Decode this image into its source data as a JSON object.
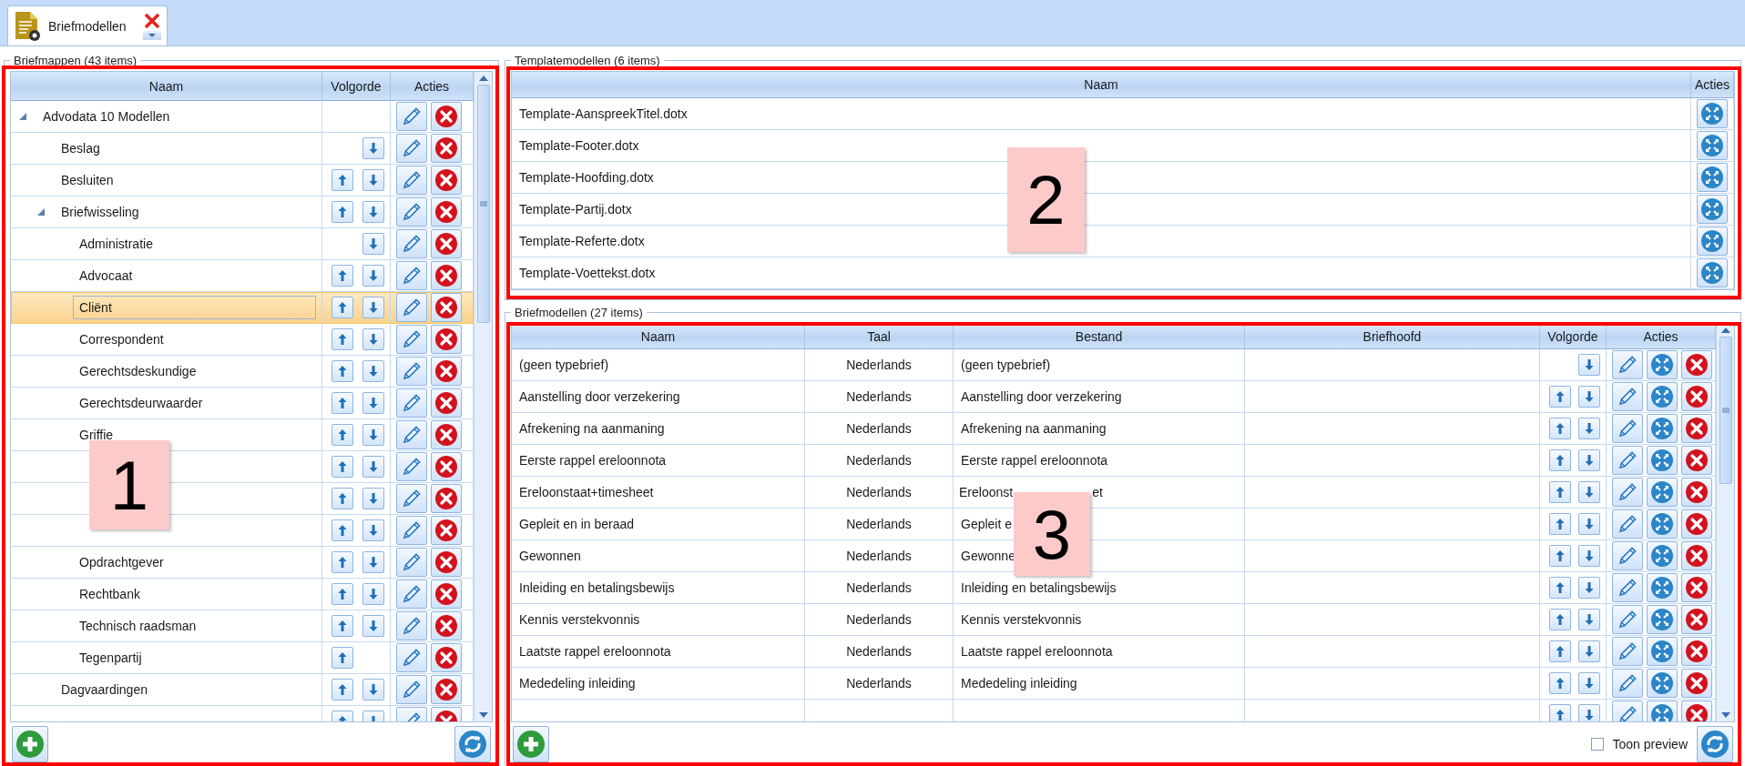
{
  "tab": {
    "title": "Briefmodellen"
  },
  "folders": {
    "title": "Briefmappen (43 items)",
    "columns": [
      "Naam",
      "Volgorde",
      "Acties"
    ],
    "tree": [
      {
        "name": "Advodata 10 Modellen",
        "expanded": true,
        "selected": false,
        "up": false,
        "down": false,
        "children": [
          {
            "name": "Beslag",
            "selected": false,
            "up": false,
            "down": true
          },
          {
            "name": "Besluiten",
            "selected": false,
            "up": true,
            "down": true
          },
          {
            "name": "Briefwisseling",
            "expanded": true,
            "selected": false,
            "up": true,
            "down": true,
            "children": [
              {
                "name": "Administratie",
                "selected": false,
                "up": false,
                "down": true
              },
              {
                "name": "Advocaat",
                "selected": false,
                "up": true,
                "down": true
              },
              {
                "name": "Cliënt",
                "selected": true,
                "up": true,
                "down": true
              },
              {
                "name": "Correspondent",
                "selected": false,
                "up": true,
                "down": true
              },
              {
                "name": "Gerechtsdeskundige",
                "selected": false,
                "up": true,
                "down": true
              },
              {
                "name": "Gerechtsdeurwaarder",
                "selected": false,
                "up": true,
                "down": true
              },
              {
                "name": "Griffie",
                "selected": false,
                "up": true,
                "down": true
              },
              {
                "selected": false,
                "up": true,
                "down": true
              },
              {
                "selected": false,
                "up": true,
                "down": true
              },
              {
                "selected": false,
                "up": true,
                "down": true
              },
              {
                "name": "Opdrachtgever",
                "selected": false,
                "up": true,
                "down": true
              },
              {
                "name": "Rechtbank",
                "selected": false,
                "up": true,
                "down": true
              },
              {
                "name": "Technisch raadsman",
                "selected": false,
                "up": true,
                "down": true
              },
              {
                "name": "Tegenpartij",
                "selected": false,
                "up": true,
                "down": false
              }
            ]
          },
          {
            "name": "Dagvaardingen",
            "selected": false,
            "up": true,
            "down": true
          },
          {
            "selected": false,
            "up": true,
            "down": true
          }
        ]
      }
    ]
  },
  "templates": {
    "title": "Templatemodellen (6 items)",
    "columns": [
      "Naam",
      "Acties"
    ],
    "rows": [
      {
        "name": "Template-AanspreekTitel.dotx"
      },
      {
        "name": "Template-Footer.dotx"
      },
      {
        "name": "Template-Hoofding.dotx"
      },
      {
        "name": "Template-Partij.dotx"
      },
      {
        "name": "Template-Referte.dotx"
      },
      {
        "name": "Template-Voettekst.dotx"
      }
    ]
  },
  "letters": {
    "title": "Briefmodellen (27 items)",
    "columns": [
      "Naam",
      "Taal",
      "Bestand",
      "Briefhoofd",
      "Volgorde",
      "Acties"
    ],
    "rows": [
      {
        "name": "(geen typebrief)",
        "language": "Nederlands",
        "file": "(geen typebrief)",
        "up": false,
        "down": true
      },
      {
        "name": "Aanstelling door verzekering",
        "language": "Nederlands",
        "file": "Aanstelling door verzekering",
        "up": true,
        "down": true
      },
      {
        "name": "Afrekening na aanmaning",
        "language": "Nederlands",
        "file": "Afrekening na aanmaning",
        "up": true,
        "down": true
      },
      {
        "name": "Eerste rappel ereloonnota",
        "language": "Nederlands",
        "file": "Eerste rappel ereloonnota",
        "up": true,
        "down": true
      },
      {
        "name": "Ereloonstaat+timesheet",
        "language": "Nederlands",
        "file": "Ereloonst",
        "file_tail": "et",
        "up": true,
        "down": true
      },
      {
        "name": "Gepleit en in beraad",
        "language": "Nederlands",
        "file": "Gepleit e",
        "up": true,
        "down": true
      },
      {
        "name": "Gewonnen",
        "language": "Nederlands",
        "file": "Gewonne",
        "up": true,
        "down": true
      },
      {
        "name": "Inleiding en betalingsbewijs",
        "language": "Nederlands",
        "file": "Inleiding en betalingsbewijs",
        "up": true,
        "down": true
      },
      {
        "name": "Kennis verstekvonnis",
        "language": "Nederlands",
        "file": "Kennis verstekvonnis",
        "up": true,
        "down": true
      },
      {
        "name": "Laatste rappel ereloonnota",
        "language": "Nederlands",
        "file": "Laatste rappel ereloonnota",
        "up": true,
        "down": true
      },
      {
        "name": "Mededeling inleiding",
        "language": "Nederlands",
        "file": "Mededeling inleiding",
        "up": true,
        "down": true
      },
      {
        "up": true,
        "down": true
      }
    ],
    "preview": {
      "label": "Toon preview",
      "checked": false
    }
  },
  "annotations": [
    {
      "label": "1"
    },
    {
      "label": "2"
    },
    {
      "label": "3"
    }
  ]
}
